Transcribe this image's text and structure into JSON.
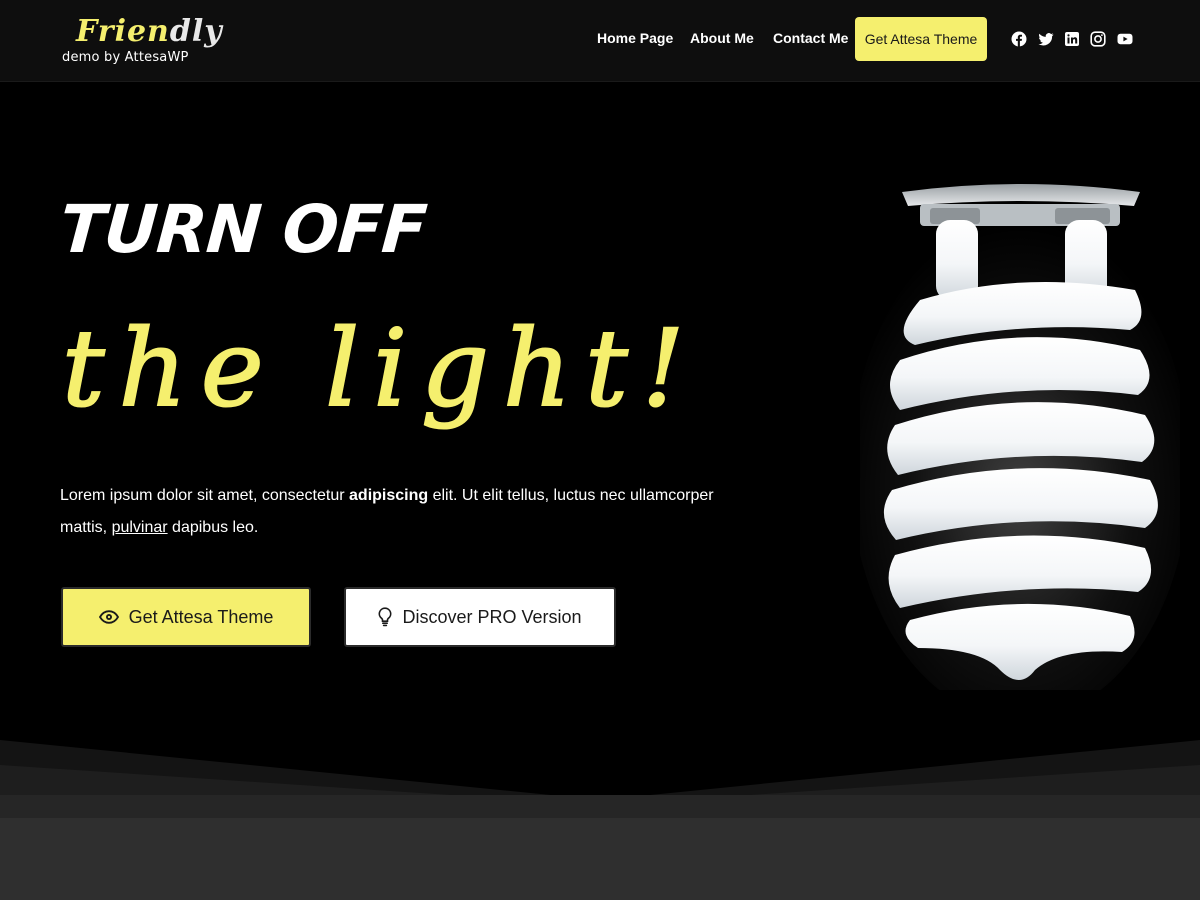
{
  "brand": {
    "logo_part1": "Frien",
    "logo_part2": "dly",
    "tagline": "demo by AttesaWP"
  },
  "nav": {
    "items": [
      "Home Page",
      "About Me",
      "Contact Me"
    ],
    "cta_label": "Get Attesa Theme",
    "social_icons": [
      "facebook-icon",
      "twitter-icon",
      "linkedin-icon",
      "instagram-icon",
      "youtube-icon"
    ]
  },
  "hero": {
    "heading_line1": "TURN OFF",
    "heading_line2": "the light!",
    "lead_text_1": "Lorem ipsum dolor sit amet, consectetur ",
    "lead_bold": "adipiscing",
    "lead_text_2": " elit. Ut elit tellus, luctus nec ullamcorper mattis, ",
    "lead_link": "pulvinar",
    "lead_text_3": " dapibus leo.",
    "primary_button": "Get Attesa Theme",
    "secondary_button": "Discover PRO Version"
  },
  "colors": {
    "accent": "#f5ef6e",
    "background": "#000000",
    "header_bg": "#0e0e0e",
    "footer_band": "#2f2f2f"
  }
}
